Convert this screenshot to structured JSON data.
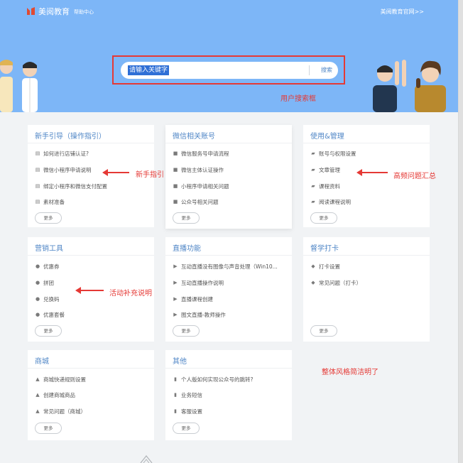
{
  "header": {
    "brand": "美阅教育",
    "brand_sub": "帮助中心",
    "official_link": "美阅教育官网>>"
  },
  "search": {
    "query": "请输入关键字",
    "button": "搜索"
  },
  "annotations": {
    "search": "用户搜索框",
    "newbie": "新手指引",
    "faq": "高频问题汇总",
    "activity": "活动补充说明",
    "style": "整体风格简洁明了"
  },
  "cards": [
    {
      "title": "新手引导（操作指引）",
      "items": [
        {
          "label": "如何进行店铺认证?",
          "icon": "book-icon"
        },
        {
          "label": "微信小程序申请说明",
          "icon": "book-icon"
        },
        {
          "label": "绑定小程序和微信支付配置",
          "icon": "book-icon"
        },
        {
          "label": "素材准备",
          "icon": "book-icon"
        }
      ],
      "more": "更多"
    },
    {
      "title": "微信相关账号",
      "items": [
        {
          "label": "微信服务号申请流程",
          "icon": "square-icon"
        },
        {
          "label": "微信主体认证操作",
          "icon": "square-icon"
        },
        {
          "label": "小程序申请相关问题",
          "icon": "square-icon"
        },
        {
          "label": "公众号相关问题",
          "icon": "square-icon"
        }
      ],
      "more": "更多"
    },
    {
      "title": "使用&管理",
      "items": [
        {
          "label": "账号与权限设置",
          "icon": "folder-icon"
        },
        {
          "label": "文章管理",
          "icon": "folder-icon"
        },
        {
          "label": "课程资料",
          "icon": "folder-icon"
        },
        {
          "label": "阅读课程说明",
          "icon": "folder-icon"
        }
      ],
      "more": "更多"
    },
    {
      "title": "营销工具",
      "items": [
        {
          "label": "优惠券",
          "icon": "users-icon"
        },
        {
          "label": "拼团",
          "icon": "users-icon"
        },
        {
          "label": "兑换码",
          "icon": "users-icon"
        },
        {
          "label": "优惠套餐",
          "icon": "users-icon"
        }
      ],
      "more": "更多"
    },
    {
      "title": "直播功能",
      "items": [
        {
          "label": "互动直播没有图像与声音处理（Win10...",
          "icon": "video-icon"
        },
        {
          "label": "互动直播操作说明",
          "icon": "video-icon"
        },
        {
          "label": "直播课程创建",
          "icon": "video-icon"
        },
        {
          "label": "图文直播-教师操作",
          "icon": "video-icon"
        }
      ],
      "more": "更多"
    },
    {
      "title": "督学打卡",
      "items": [
        {
          "label": "打卡设置",
          "icon": "tag-icon"
        },
        {
          "label": "常见问题（打卡）",
          "icon": "tag-icon"
        }
      ],
      "more": "更多"
    },
    {
      "title": "商城",
      "items": [
        {
          "label": "商城快递规则设置",
          "icon": "bell-icon"
        },
        {
          "label": "创建商城商品",
          "icon": "bell-icon"
        },
        {
          "label": "常见问题（商城）",
          "icon": "bell-icon"
        }
      ],
      "more": "更多"
    },
    {
      "title": "其他",
      "items": [
        {
          "label": "个人版如何实现公众号的跳转?",
          "icon": "bookmark-icon"
        },
        {
          "label": "业务短信",
          "icon": "bookmark-icon"
        },
        {
          "label": "客服设置",
          "icon": "bookmark-icon"
        }
      ],
      "more": "更多"
    }
  ],
  "colors": {
    "hero": "#7db6f7",
    "accent": "#4f86c6",
    "annotation": "#e53935",
    "background": "#f1f3f5"
  }
}
